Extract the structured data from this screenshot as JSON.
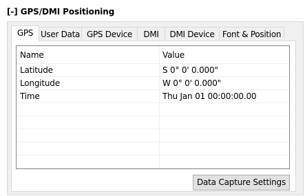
{
  "section": {
    "title": "[-] GPS/DMI Positioning"
  },
  "tabs": [
    {
      "label": "GPS",
      "active": true
    },
    {
      "label": "User Data",
      "active": false
    },
    {
      "label": "GPS Device",
      "active": false
    },
    {
      "label": "DMI",
      "active": false
    },
    {
      "label": "DMI Device",
      "active": false
    },
    {
      "label": "Font & Position",
      "active": false
    }
  ],
  "grid": {
    "columns": {
      "name": "Name",
      "value": "Value"
    },
    "rows": [
      {
        "name": "Latitude",
        "value": "S 0° 0' 0.000\""
      },
      {
        "name": "Longitude",
        "value": "W 0° 0' 0.000\""
      },
      {
        "name": "Time",
        "value": "Thu Jan 01 00:00:00.00"
      },
      {
        "name": "",
        "value": ""
      },
      {
        "name": "",
        "value": ""
      },
      {
        "name": "",
        "value": ""
      },
      {
        "name": "",
        "value": ""
      },
      {
        "name": "",
        "value": ""
      }
    ]
  },
  "buttons": {
    "data_capture_settings": "Data Capture Settings"
  }
}
